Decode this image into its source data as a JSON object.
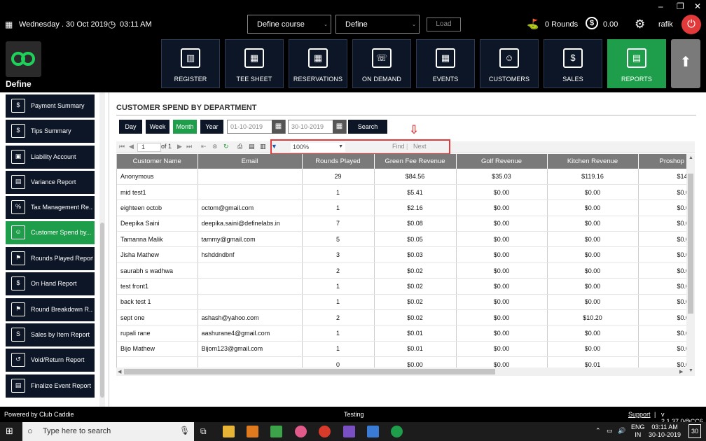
{
  "header": {
    "date": "Wednesday . 30 Oct 2019",
    "time": "03:11 AM",
    "course_select": "Define course",
    "define_select": "Define",
    "load_label": "Load",
    "rounds": "0 Rounds",
    "balance": "0.00",
    "user": "rafik"
  },
  "app": {
    "name": "Define"
  },
  "nav": [
    {
      "label": "REGISTER",
      "glyph": "▥"
    },
    {
      "label": "TEE SHEET",
      "glyph": "▦"
    },
    {
      "label": "RESERVATIONS",
      "glyph": "▦"
    },
    {
      "label": "ON DEMAND",
      "glyph": "☏"
    },
    {
      "label": "EVENTS",
      "glyph": "▦"
    },
    {
      "label": "CUSTOMERS",
      "glyph": "☺"
    },
    {
      "label": "SALES",
      "glyph": "$"
    },
    {
      "label": "REPORTS",
      "glyph": "▤"
    }
  ],
  "sidebar": [
    {
      "label": "Payment Summary",
      "glyph": "$"
    },
    {
      "label": "Tips Summary",
      "glyph": "$"
    },
    {
      "label": "Liability Account",
      "glyph": "▣"
    },
    {
      "label": "Variance Report",
      "glyph": "▤"
    },
    {
      "label": "Tax Management Re...",
      "glyph": "%"
    },
    {
      "label": "Customer Spend by...",
      "glyph": "☺"
    },
    {
      "label": "Rounds Played Report",
      "glyph": "⚑"
    },
    {
      "label": "On Hand Report",
      "glyph": "$"
    },
    {
      "label": "Round Breakdown R...",
      "glyph": "⚑"
    },
    {
      "label": "Sales by Item Report",
      "glyph": "S"
    },
    {
      "label": "Void/Return Report",
      "glyph": "↺"
    },
    {
      "label": "Finalize Event Report",
      "glyph": "▤"
    }
  ],
  "report": {
    "title": "CUSTOMER SPEND BY DEPARTMENT",
    "periods": [
      "Day",
      "Week",
      "Month",
      "Year"
    ],
    "from_date": "01-10-2019",
    "to_date": "30-10-2019",
    "search_label": "Search",
    "page": "1",
    "of_pages": "of 1",
    "zoom": "100%",
    "find_label": "Find",
    "next_label": "Next",
    "columns": [
      "Customer Name",
      "Email",
      "Rounds Played",
      "Green Fee Revenue",
      "Golf Revenue",
      "Kitchen Revenue",
      "Proshop R"
    ],
    "rows": [
      [
        "Anonymous",
        "",
        "29",
        "$84.56",
        "$35.03",
        "$119.16",
        "$14."
      ],
      [
        "mid test1",
        "",
        "1",
        "$5.41",
        "$0.00",
        "$0.00",
        "$0.0"
      ],
      [
        "eighteen octob",
        "octom@gmail.com",
        "1",
        "$2.16",
        "$0.00",
        "$0.00",
        "$0.0"
      ],
      [
        "Deepika Saini",
        "deepika.saini@definelabs.in",
        "7",
        "$0.08",
        "$0.00",
        "$0.00",
        "$0.0"
      ],
      [
        "Tamanna Malik",
        "tammy@gmail.com",
        "5",
        "$0.05",
        "$0.00",
        "$0.00",
        "$0.0"
      ],
      [
        "Jisha Mathew",
        "hshddndbnf",
        "3",
        "$0.03",
        "$0.00",
        "$0.00",
        "$0.0"
      ],
      [
        "saurabh s wadhwa",
        "",
        "2",
        "$0.02",
        "$0.00",
        "$0.00",
        "$0.0"
      ],
      [
        "test front1",
        "",
        "1",
        "$0.02",
        "$0.00",
        "$0.00",
        "$0.0"
      ],
      [
        "back test 1",
        "",
        "1",
        "$0.02",
        "$0.00",
        "$0.00",
        "$0.0"
      ],
      [
        "sept one",
        "ashash@yahoo.com",
        "2",
        "$0.02",
        "$0.00",
        "$10.20",
        "$0.0"
      ],
      [
        "rupali rane",
        "aashurane4@gmail.com",
        "1",
        "$0.01",
        "$0.00",
        "$0.00",
        "$0.0"
      ],
      [
        "Bijo Mathew",
        "Bijom123@gmail.com",
        "1",
        "$0.01",
        "$0.00",
        "$0.00",
        "$0.0"
      ],
      [
        "",
        "",
        "0",
        "$0.00",
        "$0.00",
        "$0.01",
        "$0.0"
      ]
    ]
  },
  "footer": {
    "powered": "Powered by Club Caddie",
    "env": "Testing",
    "support": "Support",
    "version": "v 2.1.37.0@CC6"
  },
  "taskbar": {
    "search_placeholder": "Type here to search",
    "lang": "ENG",
    "region": "IN",
    "time": "03:11 AM",
    "date": "30-10-2019",
    "notif_count": "30"
  },
  "colors": {
    "accent_green": "#1e9e4a",
    "tile_navy": "#0d1626",
    "highlight_red": "#e23a3a"
  }
}
